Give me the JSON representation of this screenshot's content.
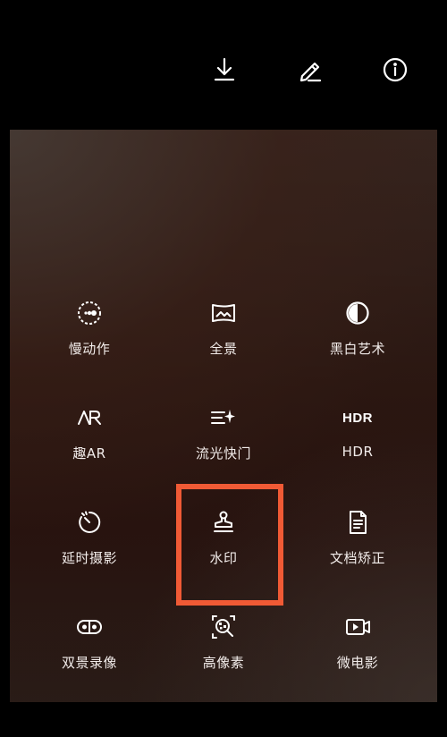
{
  "toolbar": {
    "icons": [
      "download-icon",
      "edit-icon",
      "info-icon"
    ]
  },
  "modes": [
    {
      "key": "slow-motion",
      "label": "慢动作",
      "icon": "slow-motion-icon"
    },
    {
      "key": "panorama",
      "label": "全景",
      "icon": "panorama-icon"
    },
    {
      "key": "mono-art",
      "label": "黑白艺术",
      "icon": "contrast-icon"
    },
    {
      "key": "fun-ar",
      "label": "趣AR",
      "icon": "ar-icon"
    },
    {
      "key": "light-painting",
      "label": "流光快门",
      "icon": "light-trail-icon"
    },
    {
      "key": "hdr",
      "label": "HDR",
      "icon": "hdr-icon",
      "icon_text": "HDR"
    },
    {
      "key": "time-lapse",
      "label": "延时摄影",
      "icon": "timer-icon"
    },
    {
      "key": "watermark",
      "label": "水印",
      "icon": "stamp-icon"
    },
    {
      "key": "document-scan",
      "label": "文档矫正",
      "icon": "document-icon"
    },
    {
      "key": "dual-view",
      "label": "双景录像",
      "icon": "dual-lens-icon"
    },
    {
      "key": "high-res",
      "label": "高像素",
      "icon": "high-res-icon"
    },
    {
      "key": "micro-movie",
      "label": "微电影",
      "icon": "video-play-icon"
    }
  ],
  "highlight": {
    "target": "watermark",
    "color": "#f05a35"
  },
  "colors": {
    "background": "#000000",
    "icon": "#ffffff",
    "label": "#f2ecea"
  }
}
